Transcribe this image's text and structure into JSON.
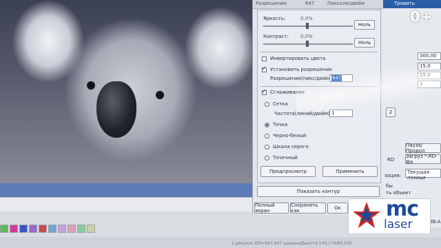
{
  "top_row": {
    "resolution_label": "Разрешение",
    "resolution_value": "647",
    "resolution_unit": "Пиксели/дюйм"
  },
  "brightness": {
    "label": "Яркость:",
    "value": "0,0%",
    "reset_label": "Ноль"
  },
  "contrast": {
    "label": "Контраст:",
    "value": "0,0%",
    "reset_label": "Ноль"
  },
  "invert_label": "Инвертировать цвета",
  "set_resolution_label": "Установить разрешение",
  "resolution_field_label": "Разрешение(пикс/дюйм)",
  "resolution_field_value": "647",
  "smoothing_label": "Сглаживание",
  "dither": {
    "grid_label": "Сетка",
    "frequency_label": "Частота(линий/дюйм):",
    "frequency_value": "1",
    "dot_label": "Точка",
    "bw_label": "Черно-белый",
    "grayscale_label": "Шкала серого",
    "point_label": "Точечный"
  },
  "preview_label": "Предпросмотр",
  "apply_label": "Применить",
  "show_contour_label": "Показать контур",
  "fullscreen_label": "Полный экран",
  "save_as_label": "Сохранить как",
  "ok_label": "Ок",
  "right_panel": {
    "tab": "Травить",
    "value_1": "300,00",
    "value_2": "15,0",
    "value_3": "15,0",
    "value_4": "1",
    "button_2": "2",
    "pause_label": "Пауза/Продол",
    "rd_label": "RD",
    "load_label": "Загруз *.RD-фа",
    "speed_label": "зация:",
    "current_pos_label": "Текущая позици",
    "line_1": "бы",
    "line_2": "ть объект",
    "coord_label": "ОВ:А"
  },
  "age_rating": "0+",
  "logo": {
    "mc": "mc",
    "laser": "laser"
  },
  "status_text": "1 рисунок DPI=647,647 ширина/Высота 143,174/83,530",
  "palette_colors": [
    "#5fb85a",
    "#d13c9a",
    "#3c55c8",
    "#9c68c8",
    "#c94a4a",
    "#6ea8d8",
    "#c8a0d8",
    "#e0a0b8",
    "#8ac8a0",
    "#c8d0a0"
  ]
}
